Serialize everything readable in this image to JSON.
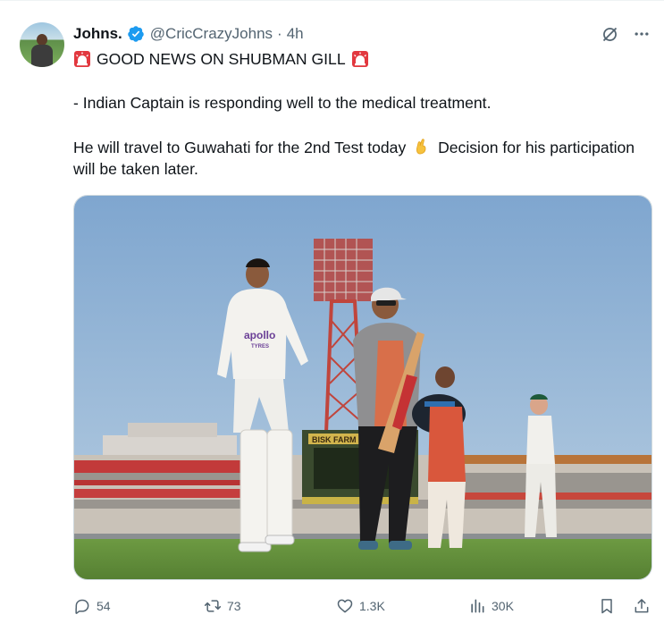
{
  "author": {
    "display_name": "Johns.",
    "handle": "@CricCrazyJohns",
    "separator": "·",
    "time": "4h",
    "verified": true,
    "verified_color": "#1d9bf0"
  },
  "tweet": {
    "headline": "GOOD NEWS ON SHUBMAN GILL",
    "paragraph_2": "- Indian Captain is responding well to the medical treatment.",
    "paragraph_3_a": "He will travel to Guwahati for the 2nd Test today",
    "paragraph_3_b": "Decision for his participation will be taken later."
  },
  "media": {
    "scoreboard_sign": "BISK FARM",
    "shirt_sponsor": "apollo",
    "shirt_sponsor_sub": "TYRES"
  },
  "actions": {
    "replies": "54",
    "reposts": "73",
    "likes": "1.3K",
    "views": "30K"
  },
  "icons": {
    "grok": "grok-icon",
    "more": "more-icon",
    "reply": "reply-icon",
    "repost": "repost-icon",
    "like": "heart-icon",
    "views": "views-icon",
    "bookmark": "bookmark-icon",
    "share": "share-icon"
  },
  "colors": {
    "text": "#0f1419",
    "muted": "#536471",
    "siren": "#e2383f"
  }
}
